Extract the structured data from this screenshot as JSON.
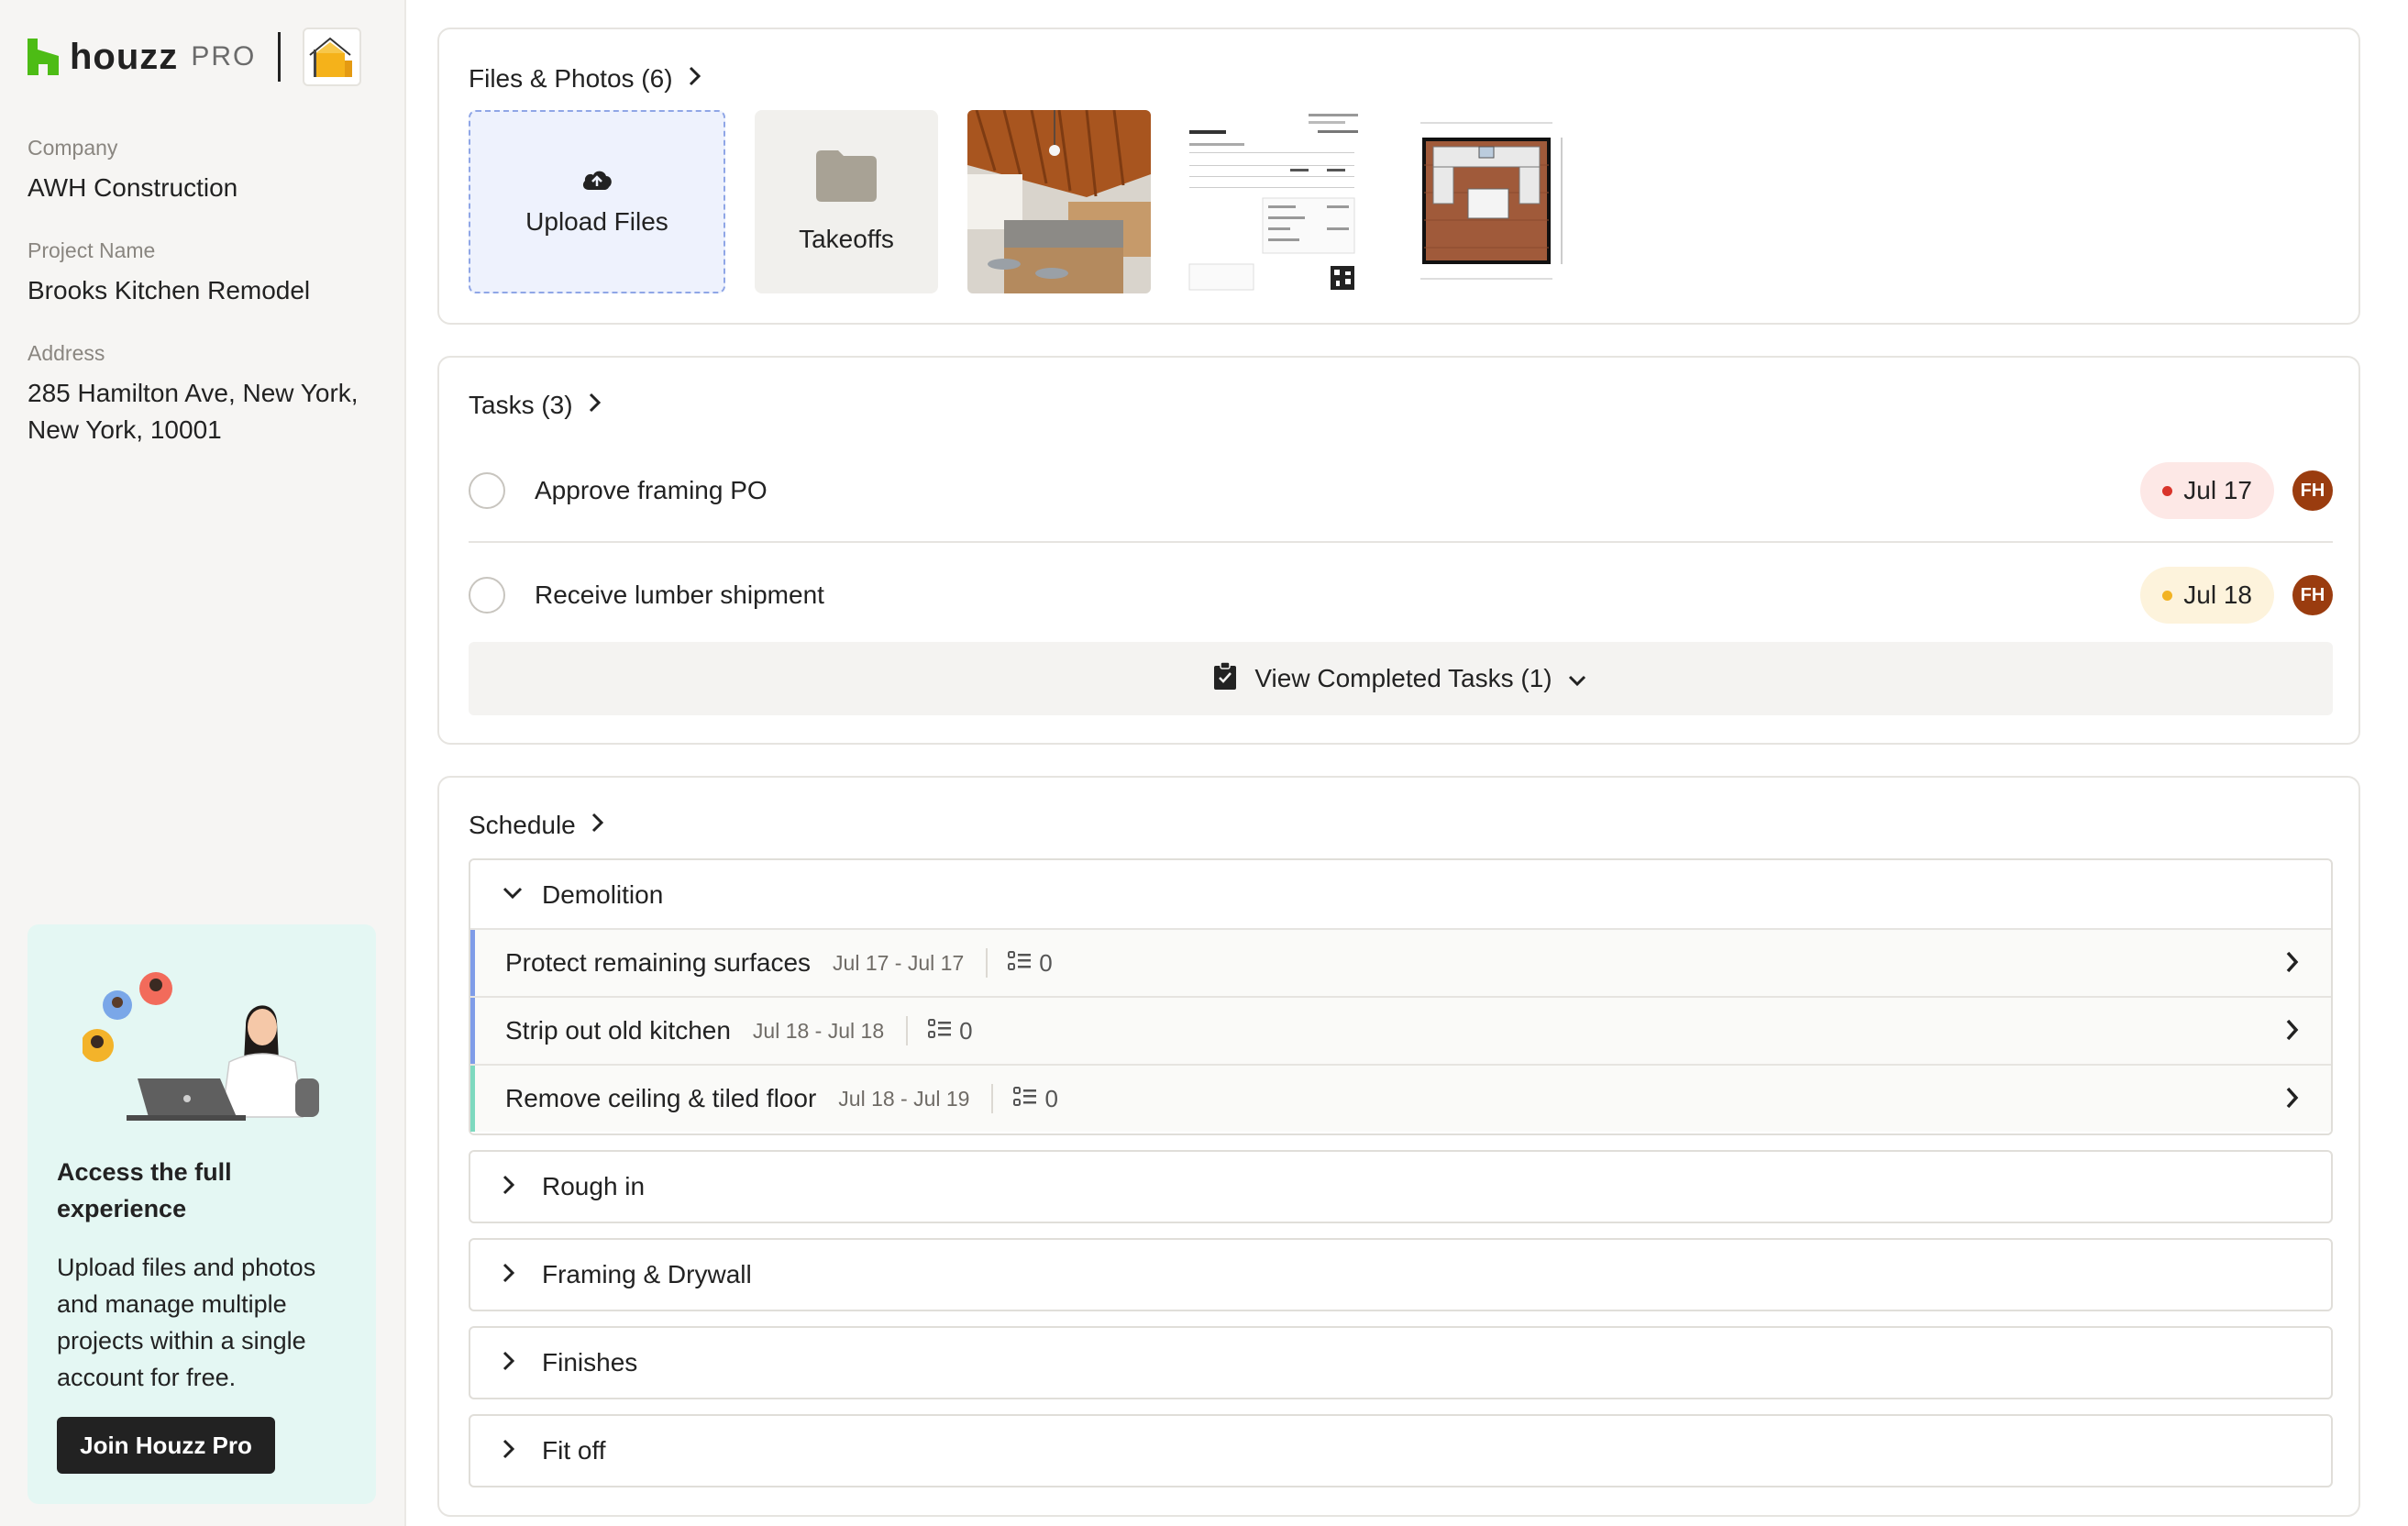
{
  "brand": {
    "wordmark": "houzz",
    "pro": "PRO",
    "accent": "#4dbc15"
  },
  "sidebar": {
    "company_label": "Company",
    "company_value": "AWH Construction",
    "project_label": "Project Name",
    "project_value": "Brooks Kitchen Remodel",
    "address_label": "Address",
    "address_line1": "285 Hamilton Ave, New York,",
    "address_line2": "New York, 10001",
    "promo": {
      "title_line1": "Access the full",
      "title_line2": "experience",
      "text_line1": "Upload files and photos",
      "text_line2": "and manage multiple",
      "text_line3": "projects within a single",
      "text_line4": "account for free.",
      "button": "Join Houzz Pro"
    }
  },
  "files": {
    "title": "Files & Photos (6)",
    "upload_label": "Upload Files",
    "takeoffs_label": "Takeoffs"
  },
  "tasks": {
    "title": "Tasks (3)",
    "items": [
      {
        "name": "Approve framing PO",
        "due": "Jul 17",
        "due_color": "#fde8e6",
        "dot_color": "#d9342b",
        "assignee": "FH"
      },
      {
        "name": "Receive lumber shipment",
        "due": "Jul 18",
        "due_color": "#fdf3dc",
        "dot_color": "#f2b324",
        "assignee": "FH"
      }
    ],
    "completed_label": "View Completed Tasks (1)"
  },
  "schedule": {
    "title": "Schedule",
    "phases": [
      {
        "name": "Demolition",
        "expanded": true
      },
      {
        "name": "Rough in",
        "expanded": false
      },
      {
        "name": "Framing & Drywall",
        "expanded": false
      },
      {
        "name": "Finishes",
        "expanded": false
      },
      {
        "name": "Fit off",
        "expanded": false
      }
    ],
    "items": [
      {
        "name": "Protect remaining surfaces",
        "dates": "Jul 17 - Jul 17",
        "count": "0",
        "accent": "#7f9ce8"
      },
      {
        "name": "Strip out old kitchen",
        "dates": "Jul 18 - Jul 18",
        "count": "0",
        "accent": "#7f9ce8"
      },
      {
        "name": "Remove ceiling & tiled floor",
        "dates": "Jul 18 - Jul 19",
        "count": "0",
        "accent": "#7dd9bf"
      }
    ]
  }
}
